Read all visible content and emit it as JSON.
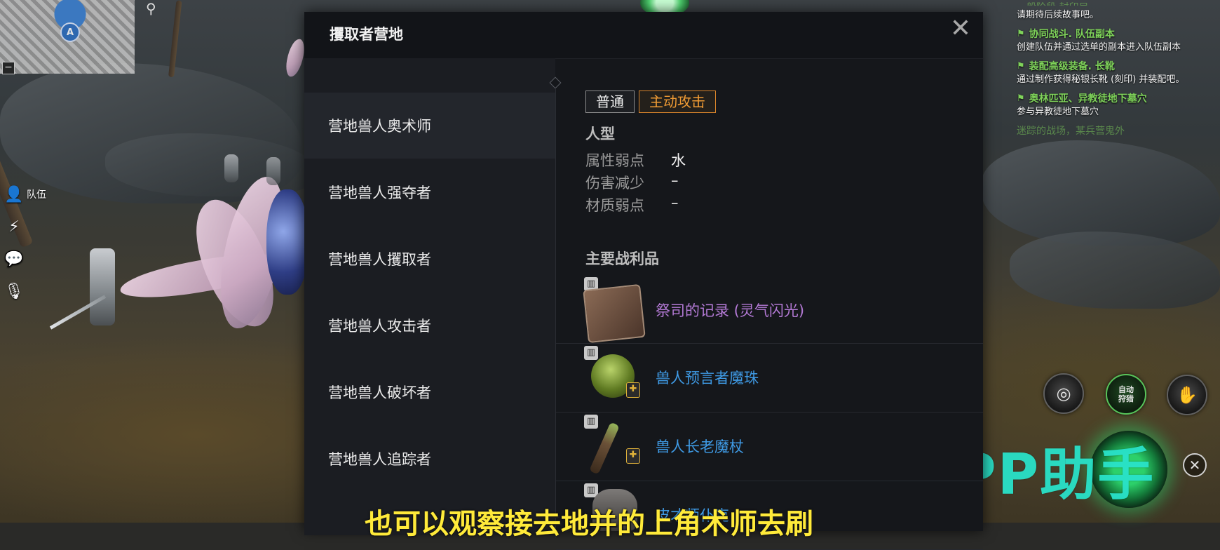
{
  "hud": {
    "minimap_marker": "A",
    "minimap_collapse": "−",
    "left_icons": [
      {
        "icon": "party-icon",
        "label": "队伍"
      },
      {
        "icon": "lightning-icon",
        "label": ""
      },
      {
        "icon": "chat-icon",
        "label": ""
      },
      {
        "icon": "microphone-icon",
        "label": ""
      }
    ]
  },
  "quests": [
    {
      "title": "",
      "desc": "请期待后续故事吧。",
      "partial_title": "一般阶段  封印目"
    },
    {
      "title": "协同战斗. 队伍副本",
      "desc": "创建队伍并通过选单的副本进入队伍副本"
    },
    {
      "title": "装配高级装备. 长靴",
      "desc": "通过制作获得秘银长靴 (刻印) 并装配吧。"
    },
    {
      "title": "奥林匹亚、异教徒地下墓穴",
      "desc": "参与异教徒地下墓穴"
    }
  ],
  "quest_partial_bottom": "迷踪的战场，某兵营鬼外",
  "actions": {
    "auto_hunt_label": "自动狩猎"
  },
  "watermark": "PP助手",
  "subtitle": "也可以观察接去地并的上角术师去刷",
  "panel": {
    "title": "攫取者营地",
    "close_glyph": "✕",
    "monsters": [
      {
        "name": "营地兽人奥术师",
        "active": true
      },
      {
        "name": "营地兽人强夺者",
        "active": false
      },
      {
        "name": "营地兽人攫取者",
        "active": false
      },
      {
        "name": "营地兽人攻击者",
        "active": false
      },
      {
        "name": "营地兽人破坏者",
        "active": false
      },
      {
        "name": "营地兽人追踪者",
        "active": false
      }
    ],
    "tabs": [
      {
        "label": "普通",
        "active": false
      },
      {
        "label": "主动攻击",
        "active": true
      }
    ],
    "race_title": "人型",
    "attributes": [
      {
        "key": "属性弱点",
        "value": "水"
      },
      {
        "key": "伤害减少",
        "value": "–"
      },
      {
        "key": "材质弱点",
        "value": "–"
      }
    ],
    "loot_title": "主要战利品",
    "loot": [
      {
        "name": "祭司的记录 (灵气闪光)",
        "color": "#b47ad6",
        "icon": "tome-icon",
        "badge": "book-icon",
        "has_shield": false
      },
      {
        "name": "兽人预言者魔珠",
        "color": "#3f9be6",
        "icon": "orb-icon",
        "badge": "book-icon",
        "has_shield": true
      },
      {
        "name": "兽人长老魔杖",
        "color": "#3f9be6",
        "icon": "staff-icon",
        "badge": "book-icon",
        "has_shield": true
      },
      {
        "name": "皮才师仆克",
        "color": "#3f9be6",
        "icon": "helm-icon",
        "badge": "book-icon",
        "has_shield": false
      }
    ],
    "colors": {
      "active_tab": "#f09b34",
      "rare_purple": "#b47ad6",
      "uncommon_blue": "#3f9be6"
    }
  }
}
